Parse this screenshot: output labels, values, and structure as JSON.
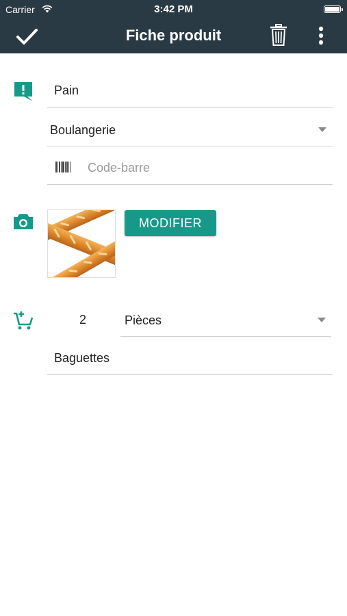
{
  "status_bar": {
    "carrier": "Carrier",
    "time": "3:42 PM"
  },
  "app_bar": {
    "title": "Fiche produit"
  },
  "product": {
    "name": "Pain",
    "category": "Boulangerie",
    "barcode_placeholder": "Code-barre",
    "modify_label": "MODIFIER"
  },
  "quantity": {
    "value": "2",
    "unit": "Pièces"
  },
  "note": {
    "text": "Baguettes"
  },
  "colors": {
    "bar": "#2a3a44",
    "accent": "#17998a"
  }
}
